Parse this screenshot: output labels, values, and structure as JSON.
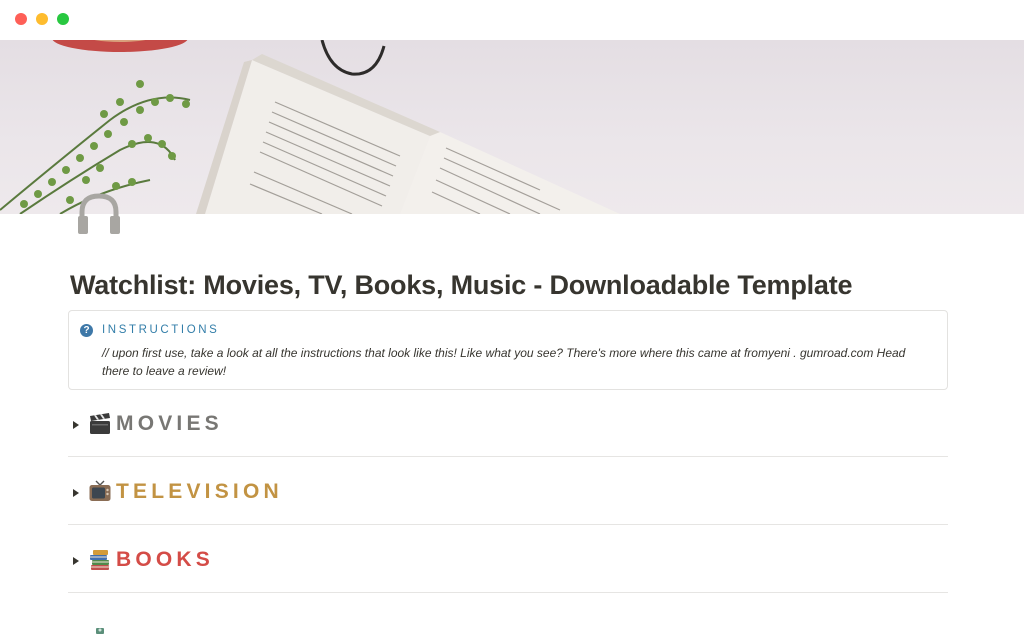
{
  "window": {
    "controls": [
      "close",
      "minimize",
      "zoom"
    ]
  },
  "page": {
    "icon": "headphones-icon",
    "title": "Watchlist: Movies, TV, Books, Music - Downloadable Template"
  },
  "callout": {
    "icon": "question-icon",
    "heading": "INSTRUCTIONS",
    "body": "// upon first use, take a look at all the instructions that look like this! Like what you see? There's more where this came at fromyeni . gumroad.com Head there to leave a review!"
  },
  "sections": [
    {
      "emoji": "clapper-board-icon",
      "label": "MOVIES",
      "color": "#787774"
    },
    {
      "emoji": "television-icon",
      "label": "TELEVISION",
      "color": "#c29343"
    },
    {
      "emoji": "books-icon",
      "label": "BOOKS",
      "color": "#d44c47"
    }
  ],
  "colors": {
    "text": "#37352f",
    "callout_heading": "#337ea9",
    "movies": "#787774",
    "television": "#c29343",
    "books": "#d44c47"
  }
}
